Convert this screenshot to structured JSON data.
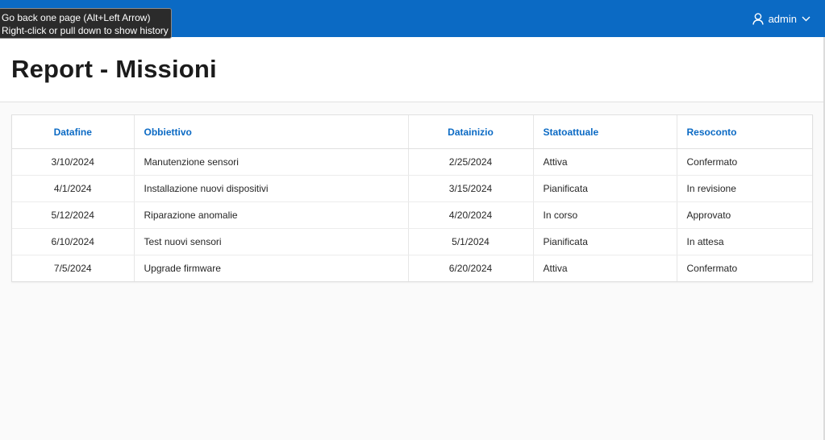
{
  "topbar": {
    "user_name": "admin",
    "user_icon": "user-icon",
    "dropdown_icon": "chevron-down-icon",
    "color": "#0b6ac4"
  },
  "tooltip": {
    "line1": "Go back one page (Alt+Left Arrow)",
    "line2": "Right-click or pull down to show history"
  },
  "page": {
    "title": "Report - Missioni"
  },
  "table": {
    "headers": [
      "Datafine",
      "Obbiettivo",
      "Datainizio",
      "Statoattuale",
      "Resoconto"
    ],
    "rows": [
      [
        "3/10/2024",
        "Manutenzione sensori",
        "2/25/2024",
        "Attiva",
        "Confermato"
      ],
      [
        "4/1/2024",
        "Installazione nuovi dispositivi",
        "3/15/2024",
        "Pianificata",
        "In revisione"
      ],
      [
        "5/12/2024",
        "Riparazione anomalie",
        "4/20/2024",
        "In corso",
        "Approvato"
      ],
      [
        "6/10/2024",
        "Test nuovi sensori",
        "5/1/2024",
        "Pianificata",
        "In attesa"
      ],
      [
        "7/5/2024",
        "Upgrade firmware",
        "6/20/2024",
        "Attiva",
        "Confermato"
      ]
    ]
  }
}
